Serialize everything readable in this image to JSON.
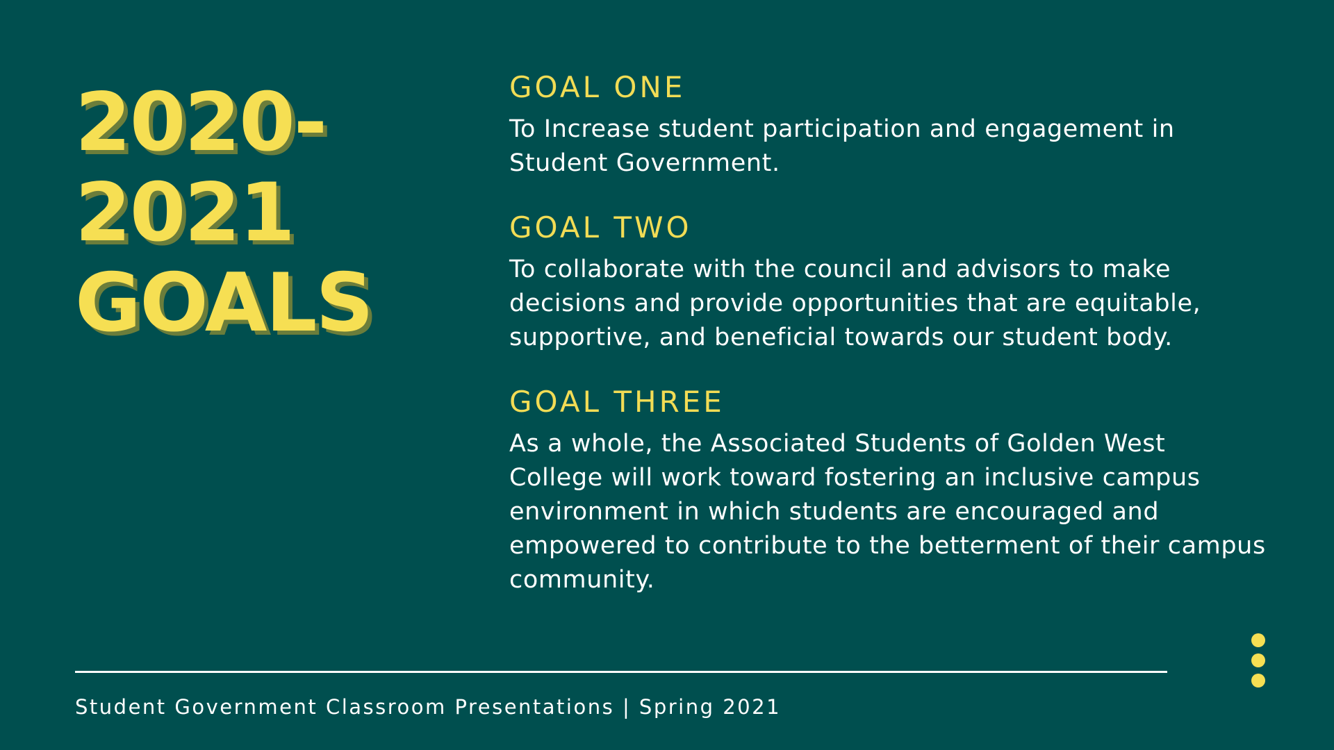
{
  "title": {
    "lines": [
      "2020-",
      "2021",
      "GOALS"
    ]
  },
  "goals": [
    {
      "heading": "GOAL ONE",
      "text": "To Increase student participation and engagement in Student Government."
    },
    {
      "heading": "GOAL TWO",
      "text": "To collaborate with the council and advisors to make decisions and provide opportunities that are equitable, supportive, and beneficial towards our student body."
    },
    {
      "heading": "GOAL THREE",
      "text": "As a whole, the Associated Students of Golden West College will work toward fostering an inclusive campus environment in which students are encouraged and empowered to contribute to the betterment of their campus community."
    }
  ],
  "footer": {
    "text": "Student Government Classroom Presentations | Spring 2021"
  },
  "colors": {
    "background": "#004f4f",
    "accent_yellow": "#f6df53",
    "text_white": "#ffffff"
  },
  "decorations": {
    "dots_icon": "vertical-ellipsis-icon",
    "dot_count": 3
  }
}
